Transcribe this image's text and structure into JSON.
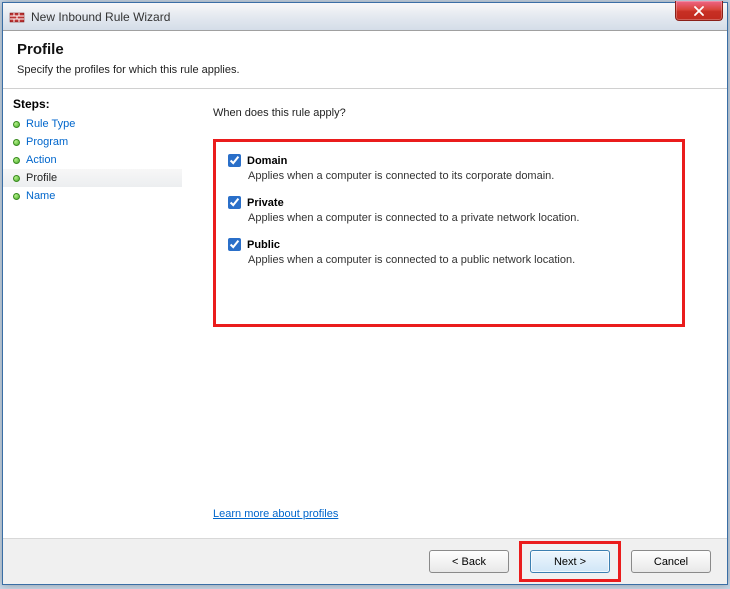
{
  "window": {
    "title": "New Inbound Rule Wizard"
  },
  "header": {
    "title": "Profile",
    "subtitle": "Specify the profiles for which this rule applies."
  },
  "sidebar": {
    "title": "Steps:",
    "items": [
      {
        "label": "Rule Type",
        "active": false
      },
      {
        "label": "Program",
        "active": false
      },
      {
        "label": "Action",
        "active": false
      },
      {
        "label": "Profile",
        "active": true
      },
      {
        "label": "Name",
        "active": false
      }
    ]
  },
  "main": {
    "question": "When does this rule apply?",
    "options": [
      {
        "label": "Domain",
        "checked": true,
        "desc": "Applies when a computer is connected to its corporate domain."
      },
      {
        "label": "Private",
        "checked": true,
        "desc": "Applies when a computer is connected to a private network location."
      },
      {
        "label": "Public",
        "checked": true,
        "desc": "Applies when a computer is connected to a public network location."
      }
    ],
    "learn_more": "Learn more about profiles"
  },
  "footer": {
    "back": "< Back",
    "next": "Next >",
    "cancel": "Cancel"
  }
}
